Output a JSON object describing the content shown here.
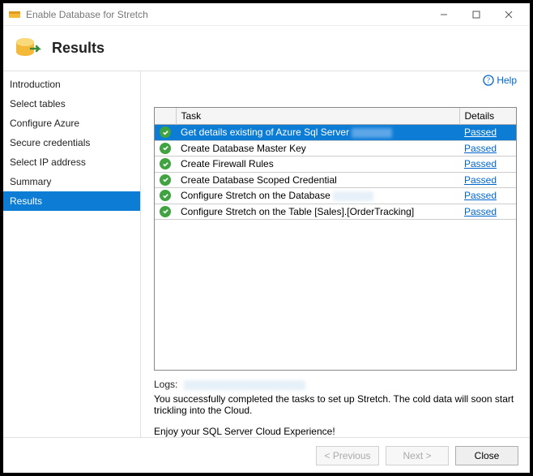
{
  "window": {
    "title": "Enable Database for Stretch"
  },
  "header": {
    "title": "Results"
  },
  "help": {
    "label": "Help"
  },
  "sidebar": {
    "items": [
      {
        "label": "Introduction"
      },
      {
        "label": "Select tables"
      },
      {
        "label": "Configure Azure"
      },
      {
        "label": "Secure credentials"
      },
      {
        "label": "Select IP address"
      },
      {
        "label": "Summary"
      },
      {
        "label": "Results"
      }
    ]
  },
  "table": {
    "headers": {
      "task": "Task",
      "details": "Details"
    },
    "rows": [
      {
        "task": "Get details existing of Azure Sql Server",
        "redacted": true,
        "detail": "Passed",
        "selected": true
      },
      {
        "task": "Create Database Master Key",
        "detail": "Passed"
      },
      {
        "task": "Create Firewall Rules",
        "detail": "Passed"
      },
      {
        "task": "Create Database Scoped Credential",
        "detail": "Passed"
      },
      {
        "task": "Configure Stretch on the Database",
        "redacted": true,
        "detail": "Passed"
      },
      {
        "task": "Configure Stretch on the Table [Sales].[OrderTracking]",
        "detail": "Passed"
      }
    ]
  },
  "logs": {
    "label": "Logs:",
    "msg1": "You successfully completed the tasks to set up Stretch. The cold data will soon start trickling into the Cloud.",
    "msg2": "Enjoy your SQL Server Cloud Experience!"
  },
  "footer": {
    "previous": "< Previous",
    "next": "Next >",
    "close": "Close"
  }
}
